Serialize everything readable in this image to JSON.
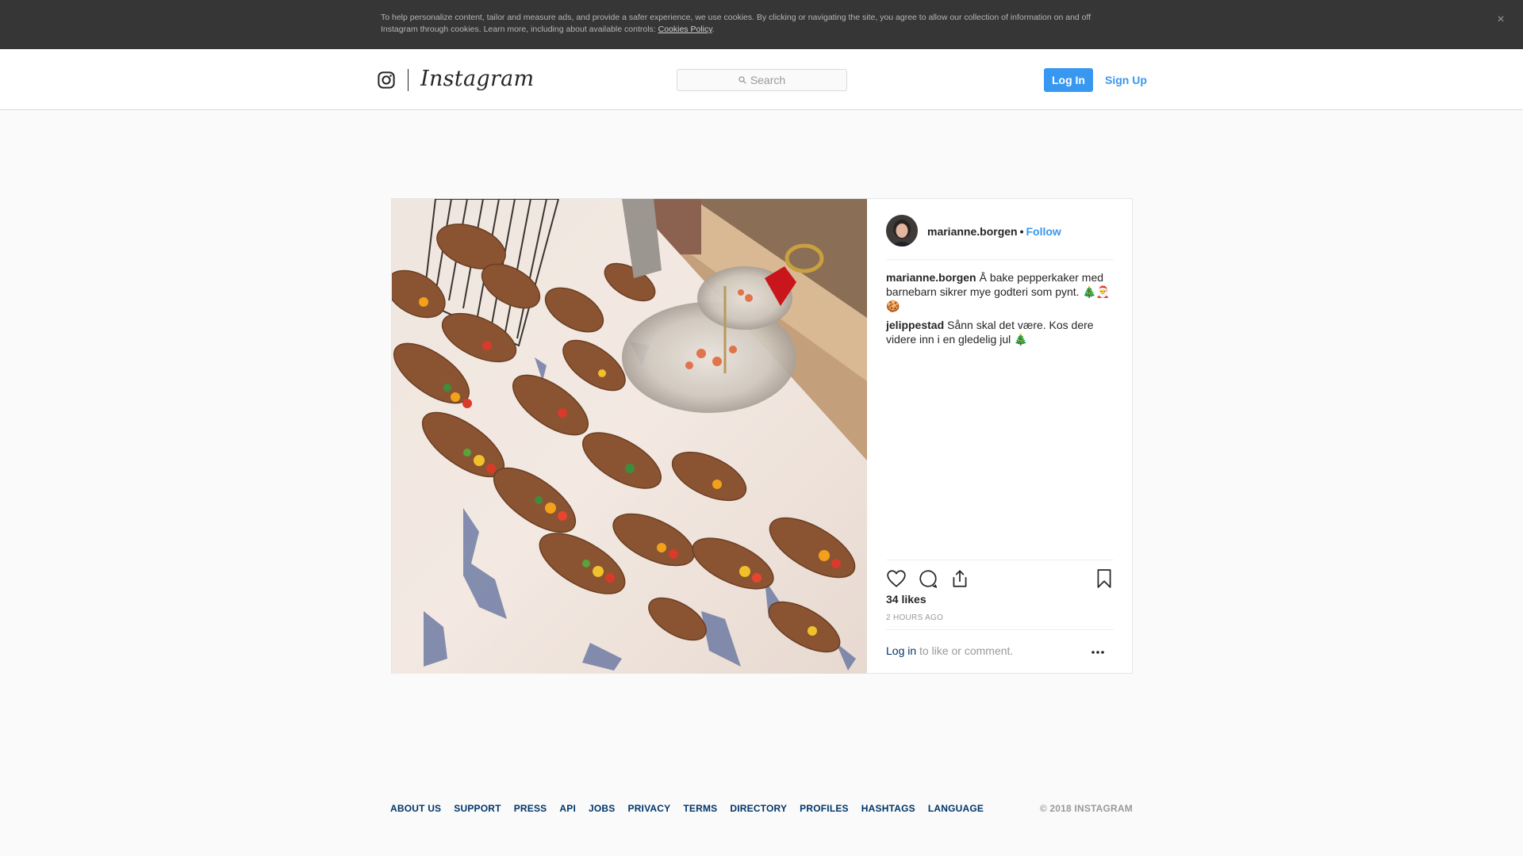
{
  "cookie_banner": {
    "text": "To help personalize content, tailor and measure ads, and provide a safer experience, we use cookies. By clicking or navigating the site, you agree to allow our collection of information on and off Instagram through cookies. Learn more, including about available controls: ",
    "link": "Cookies Policy",
    "suffix": ".",
    "close": "×"
  },
  "header": {
    "brand": "Instagram",
    "search_placeholder": "Search",
    "login": "Log In",
    "signup": "Sign Up"
  },
  "post": {
    "username": "marianne.borgen",
    "separator": "•",
    "follow": "Follow",
    "comments": [
      {
        "user": "marianne.borgen",
        "text": "Å bake pepperkaker med barnebarn sikrer mye godteri som pynt. 🎄🎅🍪"
      },
      {
        "user": "jelippestad",
        "text": "Sånn skal det være. Kos dere videre inn i en gledelig jul 🎄"
      }
    ],
    "likes": "34 likes",
    "time": "2 HOURS AGO",
    "login_prompt_link": "Log in",
    "login_prompt_text": " to like or comment."
  },
  "footer": {
    "links": [
      "About us",
      "Support",
      "Press",
      "API",
      "Jobs",
      "Privacy",
      "Terms",
      "Directory",
      "Profiles",
      "Hashtags",
      "Language"
    ],
    "copyright": "© 2018 INSTAGRAM"
  },
  "colors": {
    "accent": "#3897f0",
    "link": "#003569",
    "banner": "#363636"
  },
  "icons": [
    "instagram-glyph-icon",
    "search-icon",
    "close-icon",
    "heart-icon",
    "comment-icon",
    "share-icon",
    "bookmark-icon",
    "more-options-icon"
  ]
}
